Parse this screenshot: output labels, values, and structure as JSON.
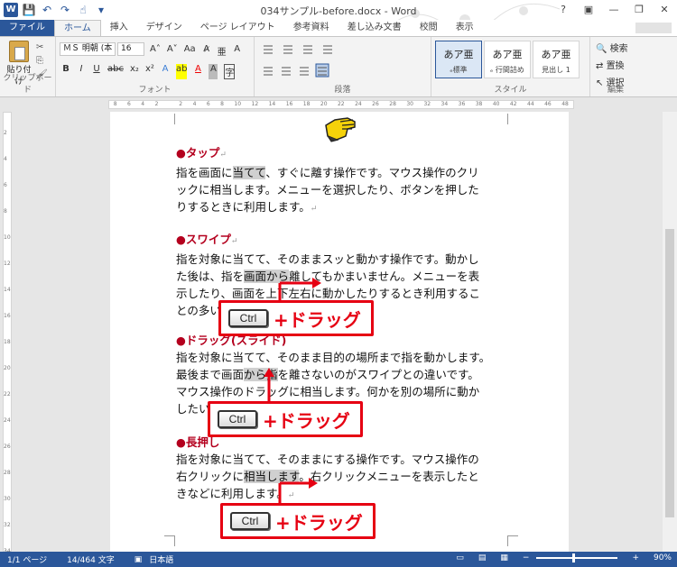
{
  "window": {
    "title": "034サンプル-before.docx - Word",
    "controls": [
      "?",
      "▣",
      "—",
      "❐",
      "✕"
    ]
  },
  "qat": {
    "word": "W",
    "save": "💾",
    "undo": "↶",
    "redo": "↷",
    "touch": "☝",
    "more": "▾"
  },
  "tabs": [
    "ファイル",
    "ホーム",
    "挿入",
    "デザイン",
    "ページ レイアウト",
    "参考資料",
    "差し込み文書",
    "校閲",
    "表示"
  ],
  "ribbon": {
    "clipboard": {
      "paste": "貼り付け",
      "cut": "✂",
      "copy": "⎘",
      "format": "🖌",
      "label": "クリップボード"
    },
    "font": {
      "name": "ＭＳ 明朝 (本",
      "size": "16",
      "grow": "A˄",
      "shrink": "A˅",
      "case": "Aa",
      "clear": "A̷",
      "phonetic": "亜",
      "enclose": "A",
      "bold": "B",
      "italic": "I",
      "underline": "U",
      "strike": "abc",
      "sub": "x₂",
      "sup": "x²",
      "effects": "A",
      "highlight": "ab",
      "color": "A",
      "charshade": "A",
      "charborder": "字",
      "label": "フォント"
    },
    "paragraph": {
      "label": "段落"
    },
    "styles": {
      "items": [
        {
          "sample": "あア亜",
          "name": "ₑ標準"
        },
        {
          "sample": "あア亜",
          "name": "ₑ 行間詰め"
        },
        {
          "sample": "あア亜",
          "name": "見出し 1"
        }
      ],
      "label": "スタイル"
    },
    "editing": {
      "find": "検索",
      "replace": "置換",
      "select": "選択",
      "label": "編集"
    }
  },
  "ruler": {
    "h": [
      "8",
      "6",
      "4",
      "2",
      "",
      "2",
      "4",
      "6",
      "8",
      "10",
      "12",
      "14",
      "16",
      "18",
      "20",
      "22",
      "24",
      "26",
      "28",
      "30",
      "32",
      "34",
      "36",
      "38",
      "40",
      "42",
      "44",
      "46",
      "48"
    ],
    "v": [
      "2",
      "4",
      "6",
      "8",
      "10",
      "12",
      "14",
      "16",
      "18",
      "20",
      "22",
      "24",
      "26",
      "28",
      "30",
      "32",
      "34"
    ]
  },
  "document": {
    "ret": "↵",
    "tap": {
      "heading": "●タップ",
      "line1a": "指を画面に",
      "line1hl": "当てて",
      "line1b": "、すぐに離す操作です。マウス操作のクリ",
      "line2": "ックに相当します。メニューを選択したり、ボタンを押した",
      "line3": "りするときに利用します。"
    },
    "swipe": {
      "heading": "●スワイプ",
      "line1": "指を対象に当てて、そのままスッと動かす操作です。動かし",
      "line2a": "た後は、指を",
      "line2hl": "画面から",
      "line2b": "離してもかまいません。メニューを表",
      "line3": "示したり、画面を上下左右に動かしたりするとき利用するこ",
      "line4": "との多い操作"
    },
    "drag": {
      "heading": "●ドラッグ(スライド)",
      "line1": "指を対象に当てて、そのまま目的の場所まで指を動かします。",
      "line2a": "最後まで画面",
      "line2hl": "から指",
      "line2b": "を離さないのがスワイプとの違いです。",
      "line3": "マウス操作のドラッグに相当します。何かを別の場所に動か",
      "line4": "したいときなどに利用します。"
    },
    "longpress": {
      "heading": "●長押し",
      "line1": "指を対象に当てて、そのままにする操作です。マウス操作の",
      "line2a": "右クリックに",
      "line2hl": "相当します",
      "line2b": "。右クリックメニューを表示したと",
      "line3": "きなどに利用します。"
    }
  },
  "callouts": {
    "key": "Ctrl",
    "text": "+ドラッグ"
  },
  "status": {
    "page": "1/1 ページ",
    "words": "14/464 文字",
    "lang": "日本語",
    "zoom": "90%",
    "minus": "−",
    "plus": "+"
  },
  "colors": {
    "accent": "#2b579a",
    "callout": "#e60012",
    "heading": "#b4001e"
  }
}
